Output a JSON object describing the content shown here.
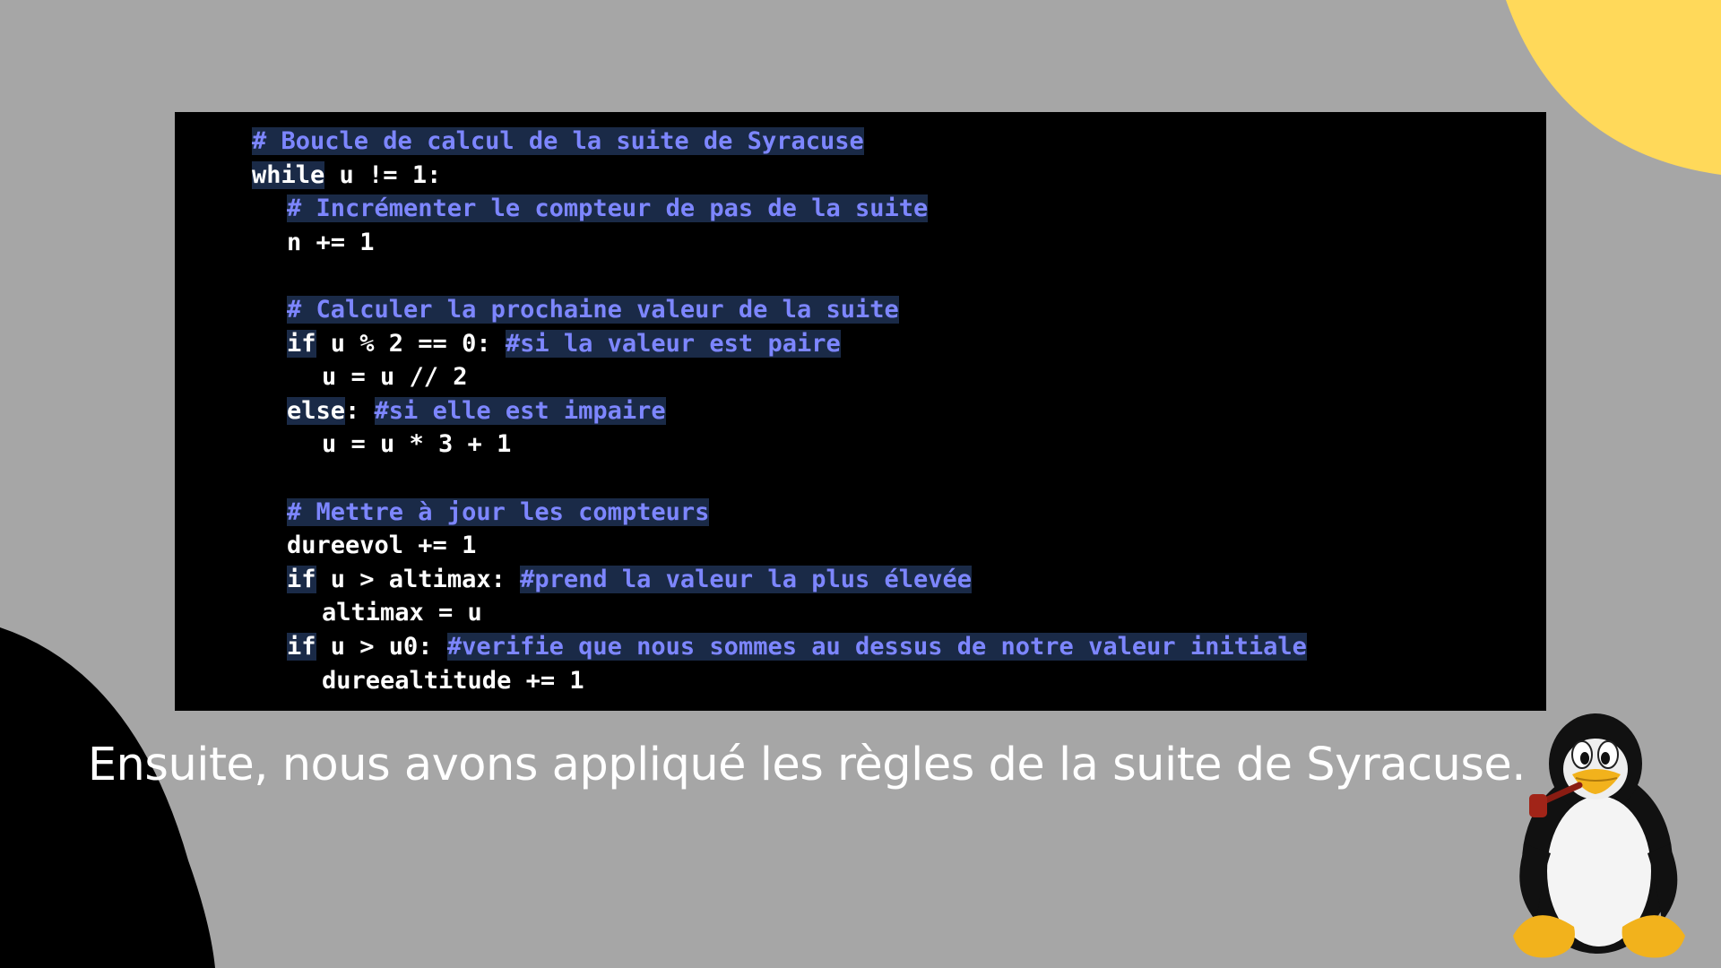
{
  "slide": {
    "caption": "Ensuite, nous avons appliqué les règles de la suite de Syracuse."
  },
  "code": {
    "line1": {
      "comment": "# Boucle de calcul de la suite de Syracuse"
    },
    "line2": {
      "keyword": "while",
      "rest": " u != 1:"
    },
    "line3": {
      "comment": "# Incrémenter le compteur de pas de la suite"
    },
    "line4": {
      "code": "n += 1"
    },
    "line6": {
      "comment": "# Calculer la prochaine valeur de la suite"
    },
    "line7": {
      "keyword": "if",
      "code": " u % 2 == 0: ",
      "comment": "#si la valeur est paire"
    },
    "line8": {
      "code": "u = u // 2"
    },
    "line9": {
      "keyword": "else",
      "code": ": ",
      "comment": "#si elle est impaire"
    },
    "line10": {
      "code": "u = u * 3 + 1"
    },
    "line12": {
      "comment": "# Mettre à jour les compteurs"
    },
    "line13": {
      "code": "dureevol += 1"
    },
    "line14": {
      "keyword": "if",
      "code": " u > altimax: ",
      "comment": "#prend la valeur la plus élevée"
    },
    "line15": {
      "code": "altimax = u"
    },
    "line16": {
      "keyword": "if",
      "code": " u > u0: ",
      "comment": "#verifie que nous sommes au dessus de notre valeur initiale"
    },
    "line17": {
      "code": "dureealtitude += 1"
    }
  },
  "colors": {
    "background": "#a6a6a6",
    "accent_yellow": "#ffd95a",
    "code_background": "#000000",
    "comment_text": "#7d86ff",
    "highlight": "#1a2a47"
  },
  "icons": {
    "mascot": "tux-penguin-icon"
  }
}
